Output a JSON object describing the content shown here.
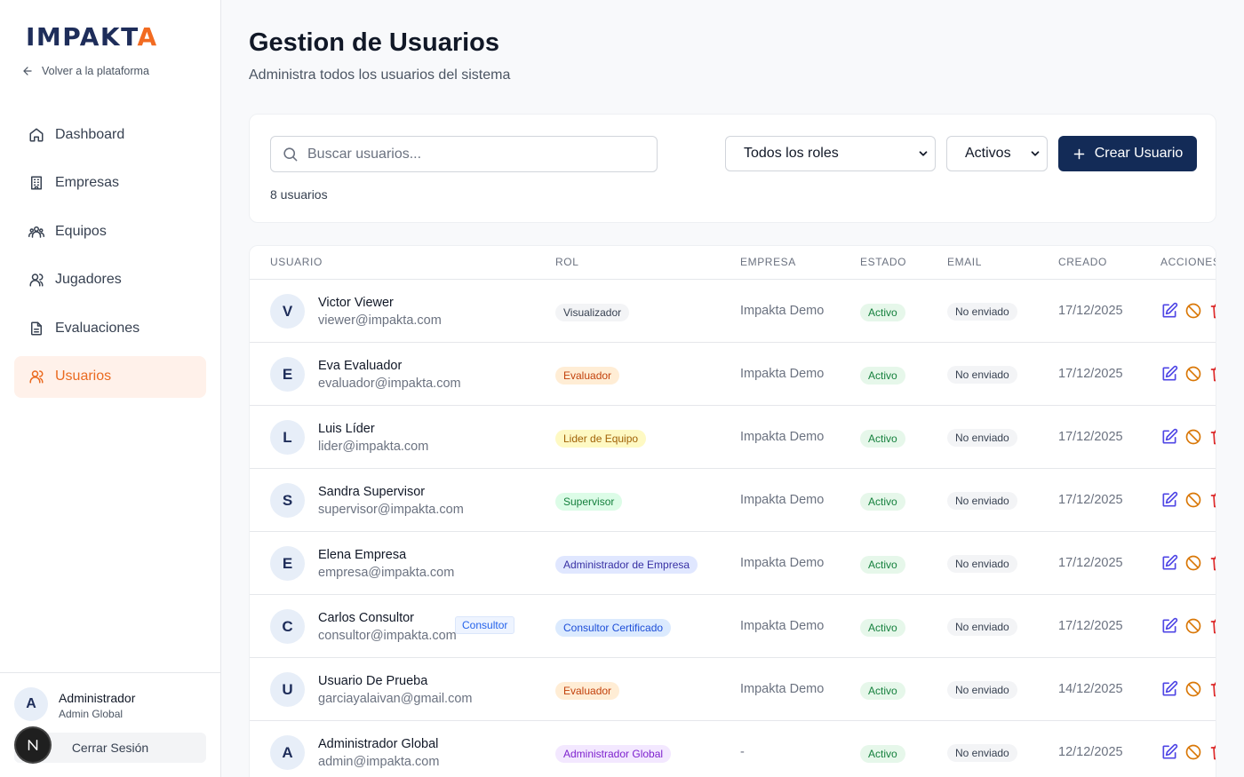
{
  "brand": {
    "logo_main": "IMPAKT",
    "logo_accent": "A",
    "back_label": "Volver a la plataforma"
  },
  "nav": [
    {
      "label": "Dashboard",
      "icon": "home-icon"
    },
    {
      "label": "Empresas",
      "icon": "building-icon"
    },
    {
      "label": "Equipos",
      "icon": "team-icon"
    },
    {
      "label": "Jugadores",
      "icon": "users-icon"
    },
    {
      "label": "Evaluaciones",
      "icon": "document-icon"
    },
    {
      "label": "Usuarios",
      "icon": "users-icon",
      "active": true
    }
  ],
  "current_user": {
    "initial": "A",
    "name": "Administrador",
    "role": "Admin Global",
    "logout_label": "Cerrar Sesión"
  },
  "header": {
    "title": "Gestion de Usuarios",
    "subtitle": "Administra todos los usuarios del sistema"
  },
  "filters": {
    "search_placeholder": "Buscar usuarios...",
    "role_select": "Todos los roles",
    "status_select": "Activos",
    "create_label": "Crear Usuario",
    "count_text": "8 usuarios"
  },
  "table": {
    "columns": [
      "Usuario",
      "Rol",
      "Empresa",
      "Estado",
      "Email",
      "Creado",
      "Acciones"
    ],
    "rows": [
      {
        "initial": "V",
        "name": "Victor Viewer",
        "email": "viewer@impakta.com",
        "badge": "",
        "role": "Visualizador",
        "role_bg": "#f3f4f6",
        "role_fg": "#374151",
        "company": "Impakta Demo",
        "status": "Activo",
        "email_status": "No enviado",
        "created": "17/12/2025"
      },
      {
        "initial": "E",
        "name": "Eva Evaluador",
        "email": "evaluador@impakta.com",
        "badge": "",
        "role": "Evaluador",
        "role_bg": "#ffedd5",
        "role_fg": "#c2410c",
        "company": "Impakta Demo",
        "status": "Activo",
        "email_status": "No enviado",
        "created": "17/12/2025"
      },
      {
        "initial": "L",
        "name": "Luis Líder",
        "email": "lider@impakta.com",
        "badge": "",
        "role": "Lider de Equipo",
        "role_bg": "#fef9c3",
        "role_fg": "#a16207",
        "company": "Impakta Demo",
        "status": "Activo",
        "email_status": "No enviado",
        "created": "17/12/2025"
      },
      {
        "initial": "S",
        "name": "Sandra Supervisor",
        "email": "supervisor@impakta.com",
        "badge": "",
        "role": "Supervisor",
        "role_bg": "#dcfce7",
        "role_fg": "#15803d",
        "company": "Impakta Demo",
        "status": "Activo",
        "email_status": "No enviado",
        "created": "17/12/2025"
      },
      {
        "initial": "E",
        "name": "Elena Empresa",
        "email": "empresa@impakta.com",
        "badge": "",
        "role": "Administrador de Empresa",
        "role_bg": "#e0e7ff",
        "role_fg": "#3730a3",
        "company": "Impakta Demo",
        "status": "Activo",
        "email_status": "No enviado",
        "created": "17/12/2025"
      },
      {
        "initial": "C",
        "name": "Carlos Consultor",
        "email": "consultor@impakta.com",
        "badge": "Consultor",
        "role": "Consultor Certificado",
        "role_bg": "#dbeafe",
        "role_fg": "#1d4ed8",
        "company": "Impakta Demo",
        "status": "Activo",
        "email_status": "No enviado",
        "created": "17/12/2025"
      },
      {
        "initial": "U",
        "name": "Usuario De Prueba",
        "email": "garciayalaivan@gmail.com",
        "badge": "",
        "role": "Evaluador",
        "role_bg": "#ffedd5",
        "role_fg": "#c2410c",
        "company": "Impakta Demo",
        "status": "Activo",
        "email_status": "No enviado",
        "created": "14/12/2025"
      },
      {
        "initial": "A",
        "name": "Administrador Global",
        "email": "admin@impakta.com",
        "badge": "",
        "role": "Administrador Global",
        "role_bg": "#f3e8ff",
        "role_fg": "#7e22ce",
        "company": "-",
        "status": "Activo",
        "email_status": "No enviado",
        "created": "12/12/2025"
      }
    ]
  },
  "colors": {
    "accent": "#ea6a20",
    "primary": "#132b57",
    "edit": "#4f46e5",
    "block": "#d97706",
    "delete": "#dc2626"
  }
}
